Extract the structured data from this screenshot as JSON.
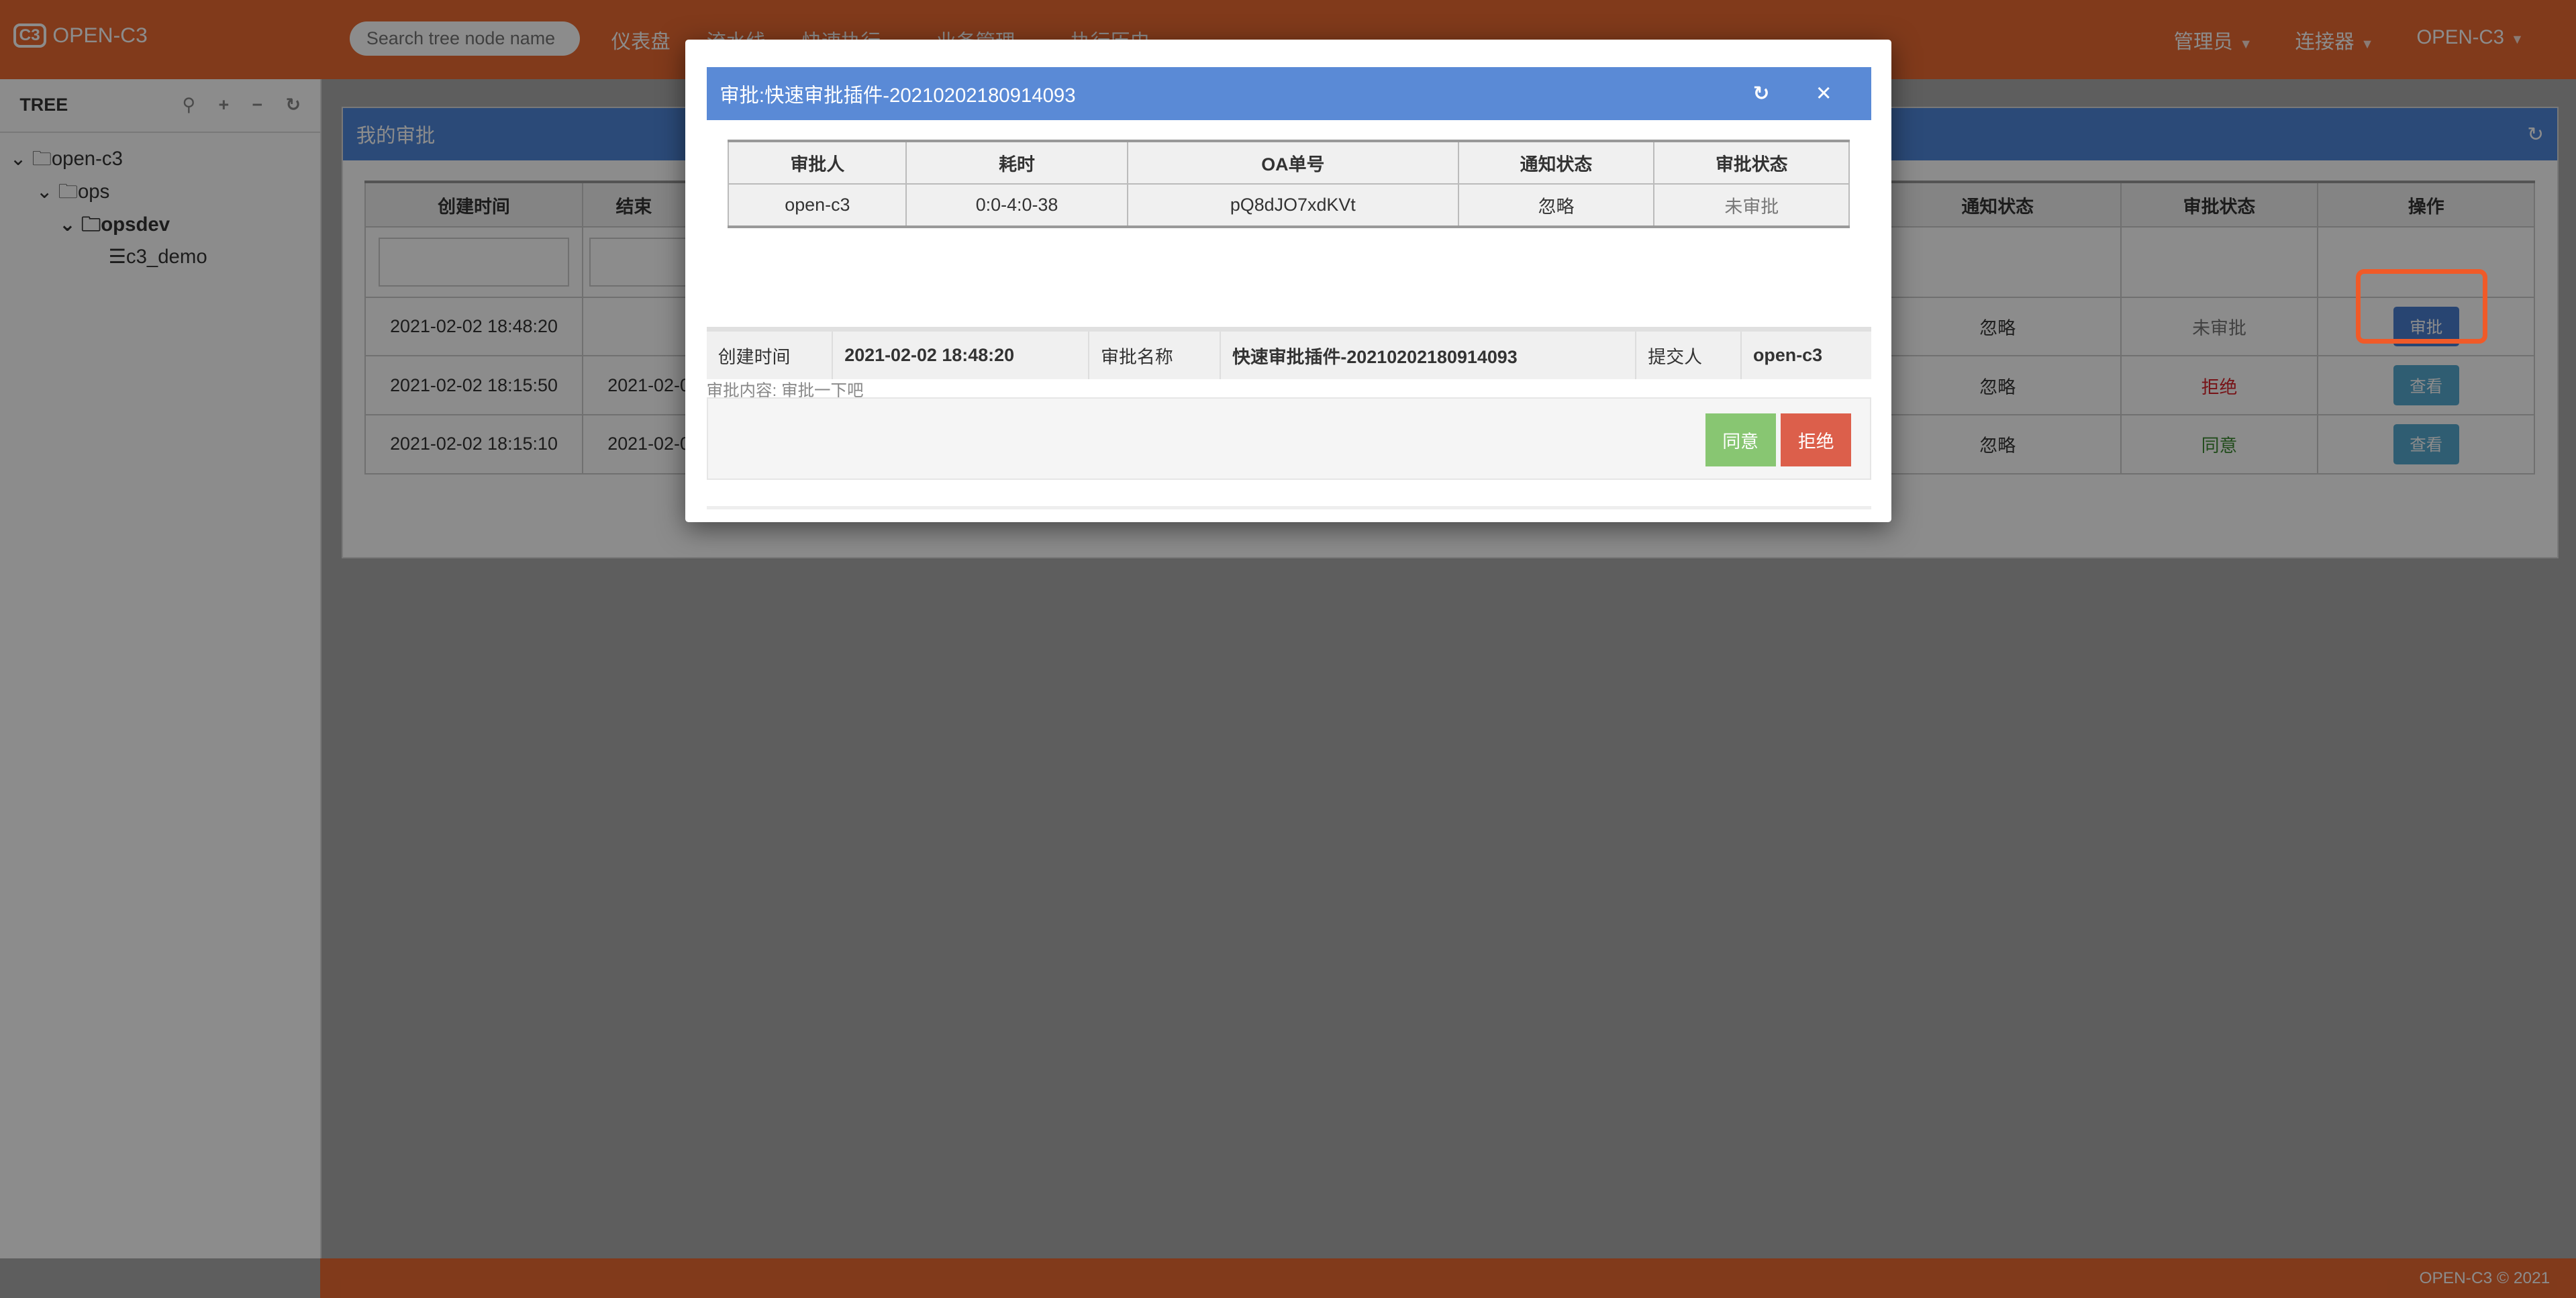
{
  "header": {
    "logo_mark": "C3",
    "logo_text": "OPEN-C3",
    "search_placeholder": "Search tree node name",
    "nav": [
      "仪表盘",
      "流水线",
      "快速执行",
      "业务管理",
      "执行历史"
    ],
    "right": [
      "管理员",
      "连接器",
      "OPEN-C3"
    ]
  },
  "sidebar": {
    "title": "TREE",
    "nodes": [
      "open-c3",
      "ops",
      "opsdev",
      "c3_demo"
    ]
  },
  "panel": {
    "title": "我的审批",
    "columns": [
      "创建时间",
      "结束",
      "通知状态",
      "审批状态",
      "操作"
    ],
    "rows": [
      {
        "created": "2021-02-02 18:48:20",
        "end": "",
        "notify": "忽略",
        "status": "未审批",
        "action": "审批"
      },
      {
        "created": "2021-02-02 18:15:50",
        "end": "2021-02-0",
        "notify": "忽略",
        "status": "拒绝",
        "action": "查看"
      },
      {
        "created": "2021-02-02 18:15:10",
        "end": "2021-02-0",
        "notify": "忽略",
        "status": "同意",
        "action": "查看"
      }
    ]
  },
  "modal": {
    "title": "审批:快速审批插件-20210202180914093",
    "table": {
      "columns": [
        "审批人",
        "耗时",
        "OA单号",
        "通知状态",
        "审批状态"
      ],
      "row": [
        "open-c3",
        "0:0-4:0-38",
        "pQ8dJO7xdKVt",
        "忽略",
        "未审批"
      ]
    },
    "info": {
      "created_label": "创建时间",
      "created": "2021-02-02 18:48:20",
      "name_label": "审批名称",
      "name": "快速审批插件-20210202180914093",
      "submitter_label": "提交人",
      "submitter": "open-c3"
    },
    "content": "审批内容: 审批一下吧",
    "agree": "同意",
    "reject": "拒绝"
  },
  "footer": "OPEN-C3 © 2021",
  "colors": {
    "brand": "#ec6a32",
    "modal_header": "#5a8ad6",
    "agree": "#88c672",
    "reject": "#dc5f4b",
    "highlight": "#f05a28"
  }
}
